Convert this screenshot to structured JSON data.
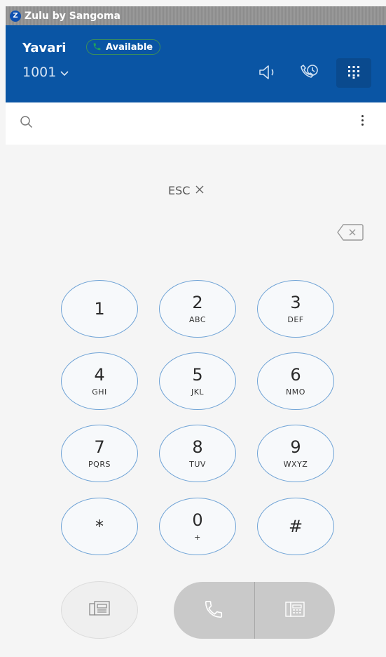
{
  "app": {
    "title": "Zulu by Sangoma",
    "logo_letter": "Z"
  },
  "header": {
    "user_name": "Yavari",
    "status_label": "Available",
    "status_color": "#1fa35a",
    "extension": "1001",
    "icons": [
      "speaker-icon",
      "call-history-icon",
      "dialpad-icon"
    ],
    "accent": "#0a55a4"
  },
  "search": {
    "placeholder": "",
    "value": ""
  },
  "dialer": {
    "esc_label": "ESC",
    "keys": [
      {
        "digit": "1",
        "letters": ""
      },
      {
        "digit": "2",
        "letters": "ABC"
      },
      {
        "digit": "3",
        "letters": "DEF"
      },
      {
        "digit": "4",
        "letters": "GHI"
      },
      {
        "digit": "5",
        "letters": "JKL"
      },
      {
        "digit": "6",
        "letters": "NMO"
      },
      {
        "digit": "7",
        "letters": "PQRS"
      },
      {
        "digit": "8",
        "letters": "TUV"
      },
      {
        "digit": "9",
        "letters": "WXYZ"
      },
      {
        "digit": "*",
        "letters": ""
      },
      {
        "digit": "0",
        "letters": "+"
      },
      {
        "digit": "#",
        "letters": ""
      }
    ]
  }
}
